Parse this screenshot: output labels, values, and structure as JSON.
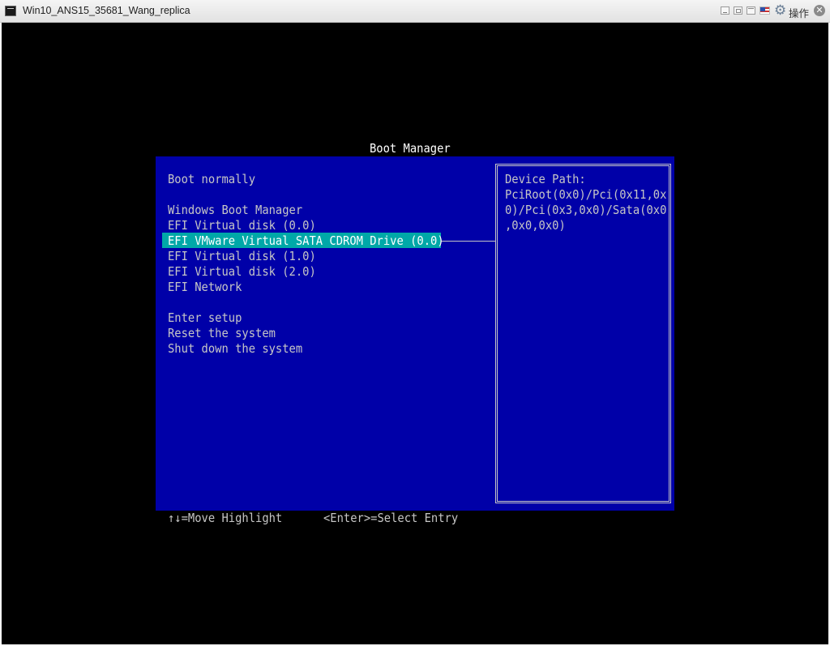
{
  "window": {
    "title": "Win10_ANS15_35681_Wang_replica",
    "ops_label": "操作"
  },
  "boot_manager": {
    "title": "Boot Manager",
    "items": [
      "Boot normally",
      "Windows Boot Manager",
      "EFI Virtual disk (0.0)",
      "EFI VMware Virtual SATA CDROM Drive (0.0)",
      "EFI Virtual disk (1.0)",
      "EFI Virtual disk (2.0)",
      "EFI Network",
      "Enter setup",
      "Reset the system",
      "Shut down the system"
    ],
    "selected_index": 3,
    "device_path_label": "Device Path:",
    "device_path_lines": [
      "PciRoot(0x0)/Pci(0x11,0x",
      "0)/Pci(0x3,0x0)/Sata(0x0",
      ",0x0,0x0)"
    ]
  },
  "footer": {
    "move_hint": "↑↓=Move Highlight",
    "select_hint": "<Enter>=Select Entry"
  },
  "colors": {
    "panel": "#0000a8",
    "highlight": "#00a8a8",
    "text": "#c6c6c6",
    "title_text": "#ffffff"
  },
  "icons": [
    "app-icon",
    "minimize-icon",
    "restore-icon",
    "maximize-icon",
    "flag-icon",
    "gear-icon",
    "close-icon"
  ]
}
